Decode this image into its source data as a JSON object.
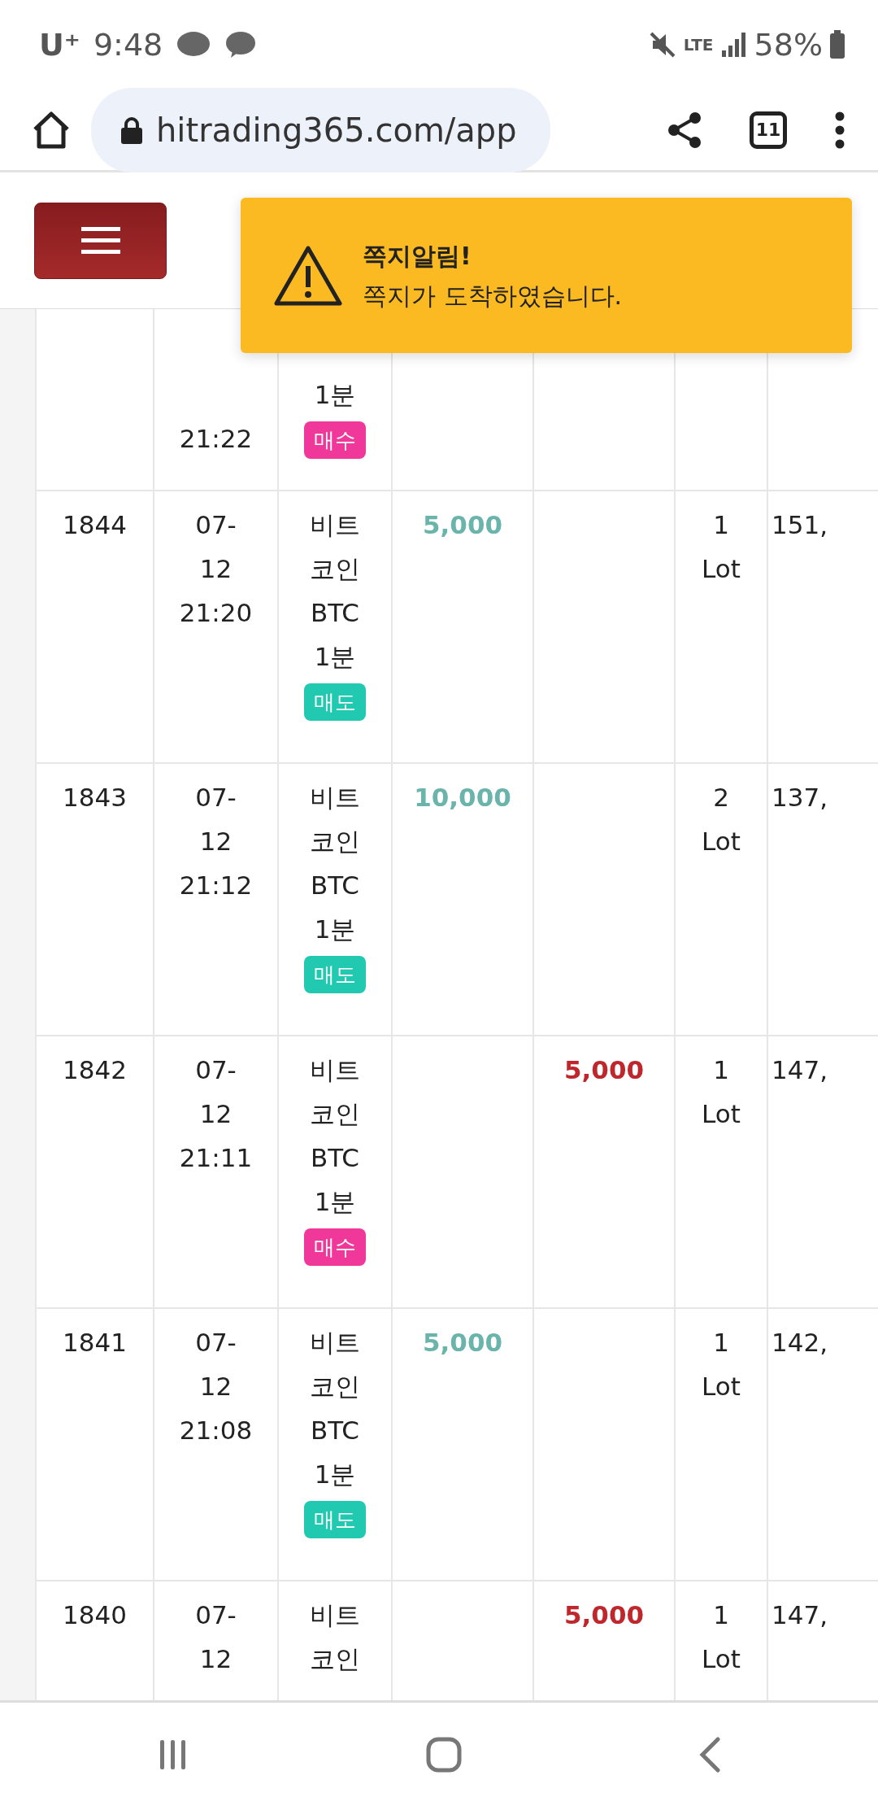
{
  "status_bar": {
    "carrier": "U⁺",
    "time": "9:48",
    "network": "LTE",
    "battery": "58%"
  },
  "browser": {
    "url": "hitrading365.com/app",
    "tab_count": "11"
  },
  "toast": {
    "title": "쪽지알림!",
    "message": "쪽지가 도착하였습니다."
  },
  "trades": [
    {
      "time_lines": [
        "21:22"
      ],
      "asset_lines": [
        "1분"
      ],
      "color": "#f0389a",
      "side_label": "매수",
      "partial": true
    },
    {
      "number": "1844",
      "time_lines": [
        "07-",
        "12",
        "21:20"
      ],
      "asset_lines": [
        "비트",
        "코인",
        "BTC",
        "1분"
      ],
      "color": "#20c9b0",
      "side_label": "매도",
      "column_4": "5,000",
      "lots_lines": [
        "1",
        "Lot"
      ],
      "column_8": "151,"
    },
    {
      "number": "1843",
      "time_lines": [
        "07-",
        "12",
        "21:12"
      ],
      "asset_lines": [
        "비트",
        "코인",
        "BTC",
        "1분"
      ],
      "color": "#20c9b0",
      "side_label": "매도",
      "column_4": "10,000",
      "lots_lines": [
        "2",
        "Lot"
      ],
      "column_8": "137,"
    },
    {
      "number": "1842",
      "time_lines": [
        "07-",
        "12",
        "21:11"
      ],
      "asset_lines": [
        "비트",
        "코인",
        "BTC",
        "1분"
      ],
      "color": "#f0389a",
      "side_label": "매수",
      "column_5": "5,000",
      "lots_lines": [
        "1",
        "Lot"
      ],
      "column_8": "147,"
    },
    {
      "number": "1841",
      "time_lines": [
        "07-",
        "12",
        "21:08"
      ],
      "asset_lines": [
        "비트",
        "코인",
        "BTC",
        "1분"
      ],
      "color": "#20c9b0",
      "side_label": "매도",
      "column_4": "5,000",
      "lots_lines": [
        "1",
        "Lot"
      ],
      "column_8": "142,"
    },
    {
      "number": "1840",
      "time_lines": [
        "07-",
        "12"
      ],
      "asset_lines": [
        "비트",
        "코인"
      ],
      "column_5": "5,000",
      "lots_lines": [
        "1",
        "Lot"
      ],
      "column_8": "147,"
    }
  ]
}
